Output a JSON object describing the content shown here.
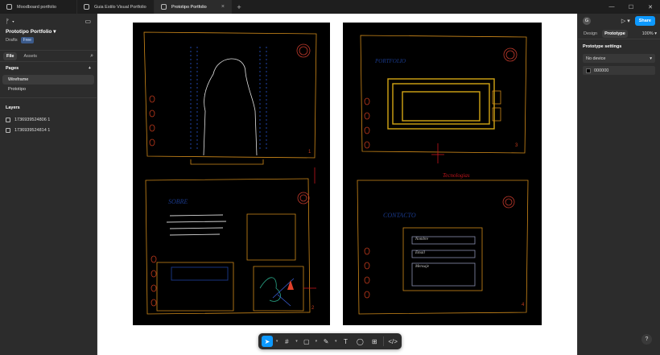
{
  "tabs": [
    {
      "label": "Moodboard portfolio",
      "active": false
    },
    {
      "label": "Guia Estilo Visual Portfolio",
      "active": false
    },
    {
      "label": "Prototipo Portfolio",
      "active": true
    }
  ],
  "project": {
    "title": "Prototipo Portfolio",
    "status": "Drafts",
    "plan": "Free"
  },
  "left_tabs": {
    "file": "File",
    "assets": "Assets"
  },
  "pages": {
    "heading": "Pages",
    "items": [
      "Wireframe",
      "Prototipo"
    ]
  },
  "layers": {
    "heading": "Layers",
    "items": [
      "1736939524806 1",
      "1736939524814 1"
    ]
  },
  "right": {
    "avatar": "G",
    "share": "Share",
    "design_tab": "Design",
    "prototype_tab": "Prototype",
    "zoom": "100%",
    "settings_heading": "Prototype settings",
    "device": "No device",
    "bg_color": "000000"
  },
  "help": "?",
  "sketch_text": {
    "sobre": "SOBRE",
    "portfolio": "PORTFOLIO",
    "contacto": "CONTACTO",
    "tecnologias": "Tecnologias",
    "nombre": "Nombre",
    "email": "Email",
    "mensaje": "Mensaje",
    "n1": "1",
    "n2": "2",
    "n3": "3",
    "n4": "4"
  },
  "colors": {
    "accent": "#0d99ff",
    "orange": "#e0671f",
    "red": "#c4161c",
    "yellow": "#d4a514",
    "blue": "#1a3a8c"
  }
}
